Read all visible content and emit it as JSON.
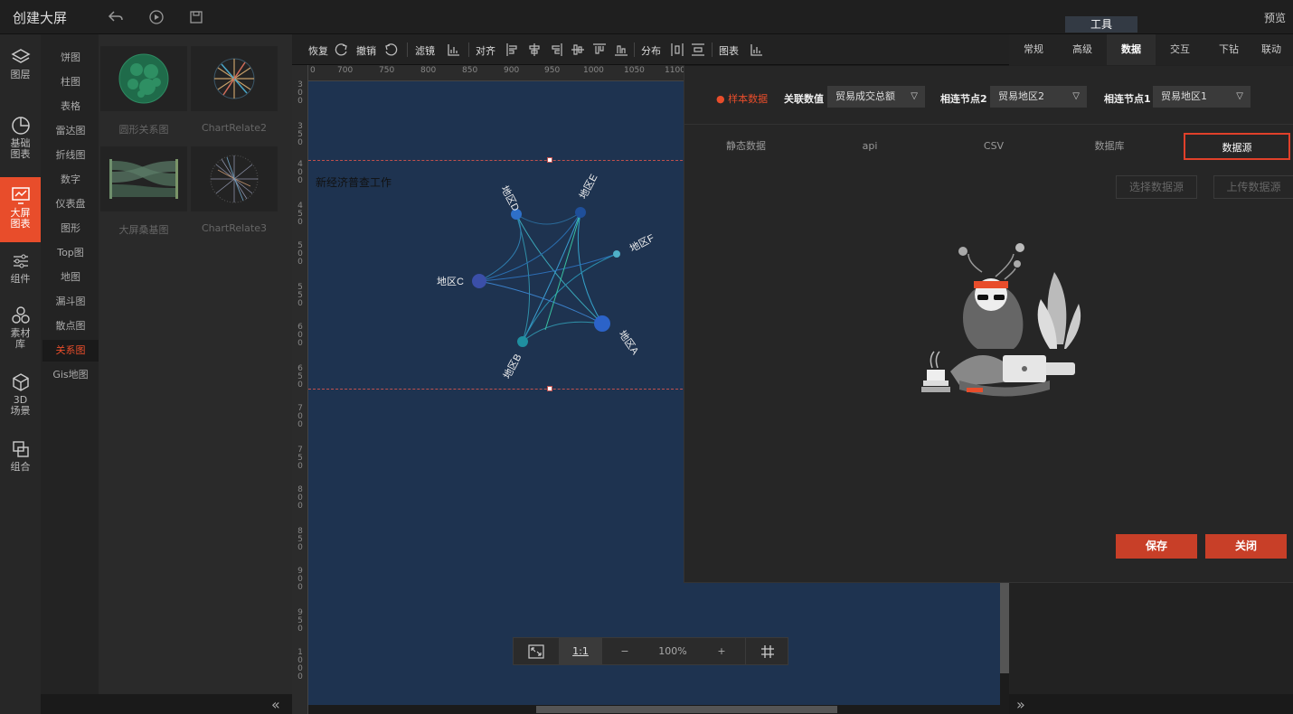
{
  "topbar": {
    "title": "创建大屏",
    "preview": "预览",
    "tools_tab": "工具"
  },
  "leftnav": [
    {
      "label": "图层",
      "icon": "layers-icon"
    },
    {
      "label": "基础图表",
      "icon": "pie-chart-icon"
    },
    {
      "label": "大屏图表",
      "icon": "monitor-chart-icon",
      "active": true
    },
    {
      "label": "组件",
      "icon": "sliders-icon"
    },
    {
      "label": "素材库",
      "icon": "assets-icon"
    },
    {
      "label": "3D场景",
      "icon": "cube-icon"
    },
    {
      "label": "组合",
      "icon": "group-icon"
    }
  ],
  "categories": [
    "饼图",
    "柱图",
    "表格",
    "雷达图",
    "折线图",
    "数字",
    "仪表盘",
    "图形",
    "Top图",
    "地图",
    "漏斗图",
    "散点图",
    "关系图",
    "Gis地图"
  ],
  "active_category": "关系图",
  "thumbnails": [
    "圆形关系图",
    "ChartRelate2",
    "大屏桑基图",
    "ChartRelate3"
  ],
  "toolbar": {
    "redo": "恢复",
    "undo": "撤销",
    "filter": "滤镜",
    "align": "对齐",
    "distribute": "分布",
    "chart": "图表"
  },
  "ruler": {
    "top": [
      "0",
      "700",
      "750",
      "800",
      "850",
      "900",
      "950",
      "1000",
      "1050",
      "1100"
    ],
    "left": [
      "300",
      "350",
      "400",
      "450",
      "500",
      "550",
      "600",
      "650",
      "700",
      "750",
      "800",
      "850",
      "900",
      "950",
      "1000"
    ]
  },
  "canvas": {
    "widget_title": "新经济普查工作",
    "nodes": [
      {
        "label": "地区D"
      },
      {
        "label": "地区E"
      },
      {
        "label": "地区F"
      },
      {
        "label": "地区C"
      },
      {
        "label": "地区A"
      },
      {
        "label": "地区B"
      }
    ]
  },
  "zoombar": {
    "fit_icon": "fit-screen-icon",
    "one_to_one": "1:1",
    "minus": "−",
    "zoom": "100%",
    "plus": "+",
    "grid_icon": "grid-icon"
  },
  "right_tabs": [
    "常规",
    "高级",
    "数据",
    "交互",
    "下钻",
    "联动"
  ],
  "right_active_tab": "数据",
  "dialog": {
    "sample_data": "● 样本数据",
    "assoc_value_label": "关联数值",
    "assoc_value": "贸易成交总额",
    "node2_label": "相连节点2",
    "node2_value": "贸易地区2",
    "node1_label": "相连节点1",
    "node1_value": "贸易地区1",
    "tabs": [
      "静态数据",
      "api",
      "CSV",
      "数据库",
      "数据源"
    ],
    "active_tab": "数据源",
    "select_source": "选择数据源",
    "upload_source": "上传数据源",
    "save": "保存",
    "close": "关闭"
  },
  "colors": {
    "accent": "#e84d2b",
    "canvas_bg": "#1e3350",
    "button_red": "#c83f28"
  }
}
